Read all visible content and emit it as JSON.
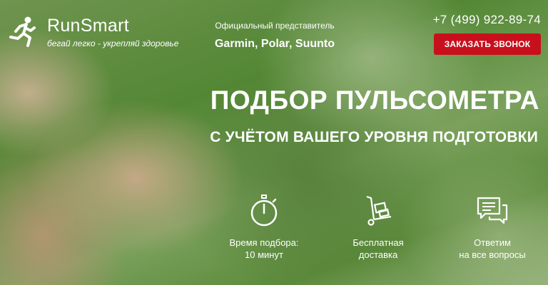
{
  "brand": {
    "name": "RunSmart",
    "tagline": "бегай легко - укрепляй здоровье"
  },
  "dealer": {
    "label": "Официальный представитель",
    "brands": "Garmin, Polar, Suunto"
  },
  "contact": {
    "phone": "+7 (499) 922-89-74",
    "callback_label": "ЗАКАЗАТЬ ЗВОНОК"
  },
  "hero": {
    "title": "ПОДБОР ПУЛЬСОМЕТРА",
    "subtitle": "С УЧЁТОМ ВАШЕГО УРОВНЯ ПОДГОТОВКИ"
  },
  "features": [
    {
      "icon": "stopwatch-icon",
      "line1": "Время подбора:",
      "line2": "10 минут"
    },
    {
      "icon": "delivery-cart-icon",
      "line1": "Бесплатная",
      "line2": "доставка"
    },
    {
      "icon": "chat-bubbles-icon",
      "line1": "Ответим",
      "line2": "на все вопросы"
    }
  ],
  "colors": {
    "accent": "#c8101d",
    "text": "#ffffff"
  }
}
